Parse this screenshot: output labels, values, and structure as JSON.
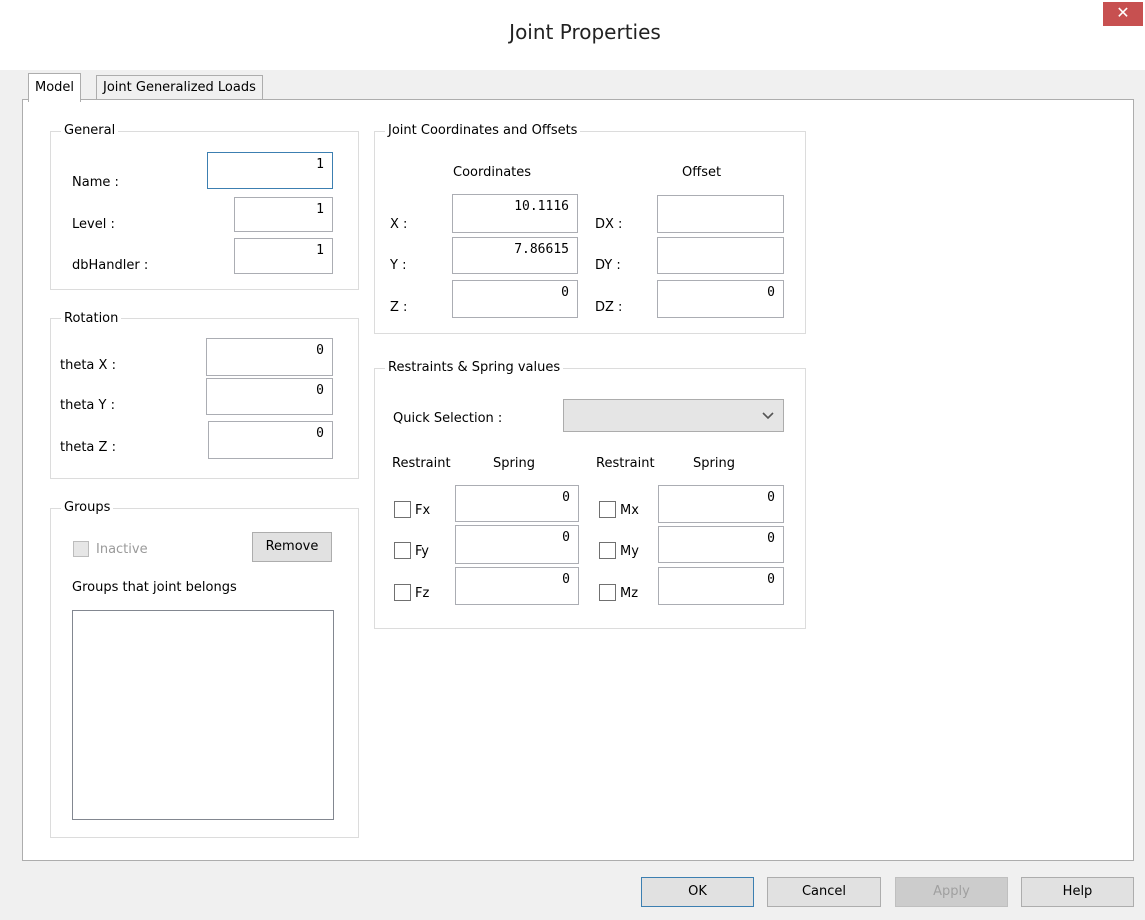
{
  "window": {
    "title": "Joint Properties",
    "close_glyph": "✕"
  },
  "tabs": [
    {
      "label": "Model"
    },
    {
      "label": "Joint Generalized Loads"
    }
  ],
  "general": {
    "title": "General",
    "name_label": "Name :",
    "name_value": "1",
    "level_label": "Level :",
    "level_value": "1",
    "dbhandler_label": "dbHandler :",
    "dbhandler_value": "1"
  },
  "rotation": {
    "title": "Rotation",
    "tx_label": "theta X :",
    "tx_value": "0",
    "ty_label": "theta Y :",
    "ty_value": "0",
    "tz_label": "theta Z :",
    "tz_value": "0"
  },
  "groups": {
    "title": "Groups",
    "inactive_label": "Inactive",
    "remove_label": "Remove",
    "belongs_label": "Groups that joint belongs"
  },
  "coords": {
    "title": "Joint Coordinates and Offsets",
    "coordinates_header": "Coordinates",
    "offset_header": "Offset",
    "x_label": "X :",
    "x_value": "10.1116",
    "y_label": "Y :",
    "y_value": "7.86615",
    "z_label": "Z :",
    "z_value": "0",
    "dx_label": "DX :",
    "dx_value": "",
    "dy_label": "DY :",
    "dy_value": "",
    "dz_label": "DZ :",
    "dz_value": "0"
  },
  "restraints": {
    "title": "Restraints & Spring values",
    "quick_label": "Quick Selection :",
    "quick_value": "",
    "restraint_header": "Restraint",
    "spring_header": "Spring",
    "fx_label": "Fx",
    "fx_value": "0",
    "fy_label": "Fy",
    "fy_value": "0",
    "fz_label": "Fz",
    "fz_value": "0",
    "mx_label": "Mx",
    "mx_value": "0",
    "my_label": "My",
    "my_value": "0",
    "mz_label": "Mz",
    "mz_value": "0"
  },
  "buttons": {
    "ok": "OK",
    "cancel": "Cancel",
    "apply": "Apply",
    "help": "Help"
  },
  "colors": {
    "close": "#c75050",
    "focus_border": "#3c7fb1"
  }
}
